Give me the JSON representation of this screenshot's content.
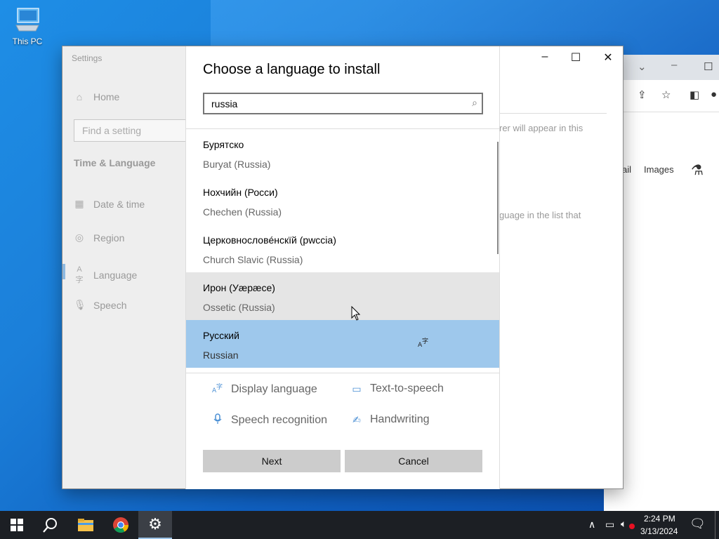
{
  "desktop": {
    "icon_label": "This PC"
  },
  "settings": {
    "title": "Settings",
    "home": "Home",
    "find_placeholder": "Find a setting",
    "section": "Time & Language",
    "nav": [
      {
        "label": "Date & time",
        "icon": "calendar-icon"
      },
      {
        "label": "Region",
        "icon": "globe-icon"
      },
      {
        "label": "Language",
        "icon": "language-icon"
      },
      {
        "label": "Speech",
        "icon": "microphone-icon"
      }
    ],
    "bg_text_1": "rer will appear in this",
    "bg_text_2": "guage in the list that"
  },
  "chrome": {
    "tab_text_1": "ail",
    "tab_text_2": "Images"
  },
  "dialog": {
    "title": "Choose a language to install",
    "search_value": "russia",
    "languages": [
      {
        "native": "Бурятско",
        "english": "Buryat (Russia)",
        "state": "normal"
      },
      {
        "native": "Нохчийн (Росси)",
        "english": "Chechen (Russia)",
        "state": "normal"
      },
      {
        "native": "Церковнословéнскїй (рwссіа)",
        "english": "Church Slavic (Russia)",
        "state": "normal"
      },
      {
        "native": "Ирон (Уæрæсе)",
        "english": "Ossetic (Russia)",
        "state": "hover"
      },
      {
        "native": "Русский",
        "english": "Russian",
        "state": "selected"
      }
    ],
    "features": {
      "display_language": "Display language",
      "text_to_speech": "Text-to-speech",
      "speech_recognition": "Speech recognition",
      "handwriting": "Handwriting"
    },
    "buttons": {
      "next": "Next",
      "cancel": "Cancel"
    }
  },
  "taskbar": {
    "time": "2:24 PM",
    "date": "3/13/2024",
    "apps": [
      "start-icon",
      "search-icon",
      "file-explorer-icon",
      "chrome-icon",
      "settings-icon"
    ]
  },
  "colors": {
    "accent": "#9ec8ec",
    "hover": "#e5e5e5",
    "taskbar": "#1c1f24"
  }
}
